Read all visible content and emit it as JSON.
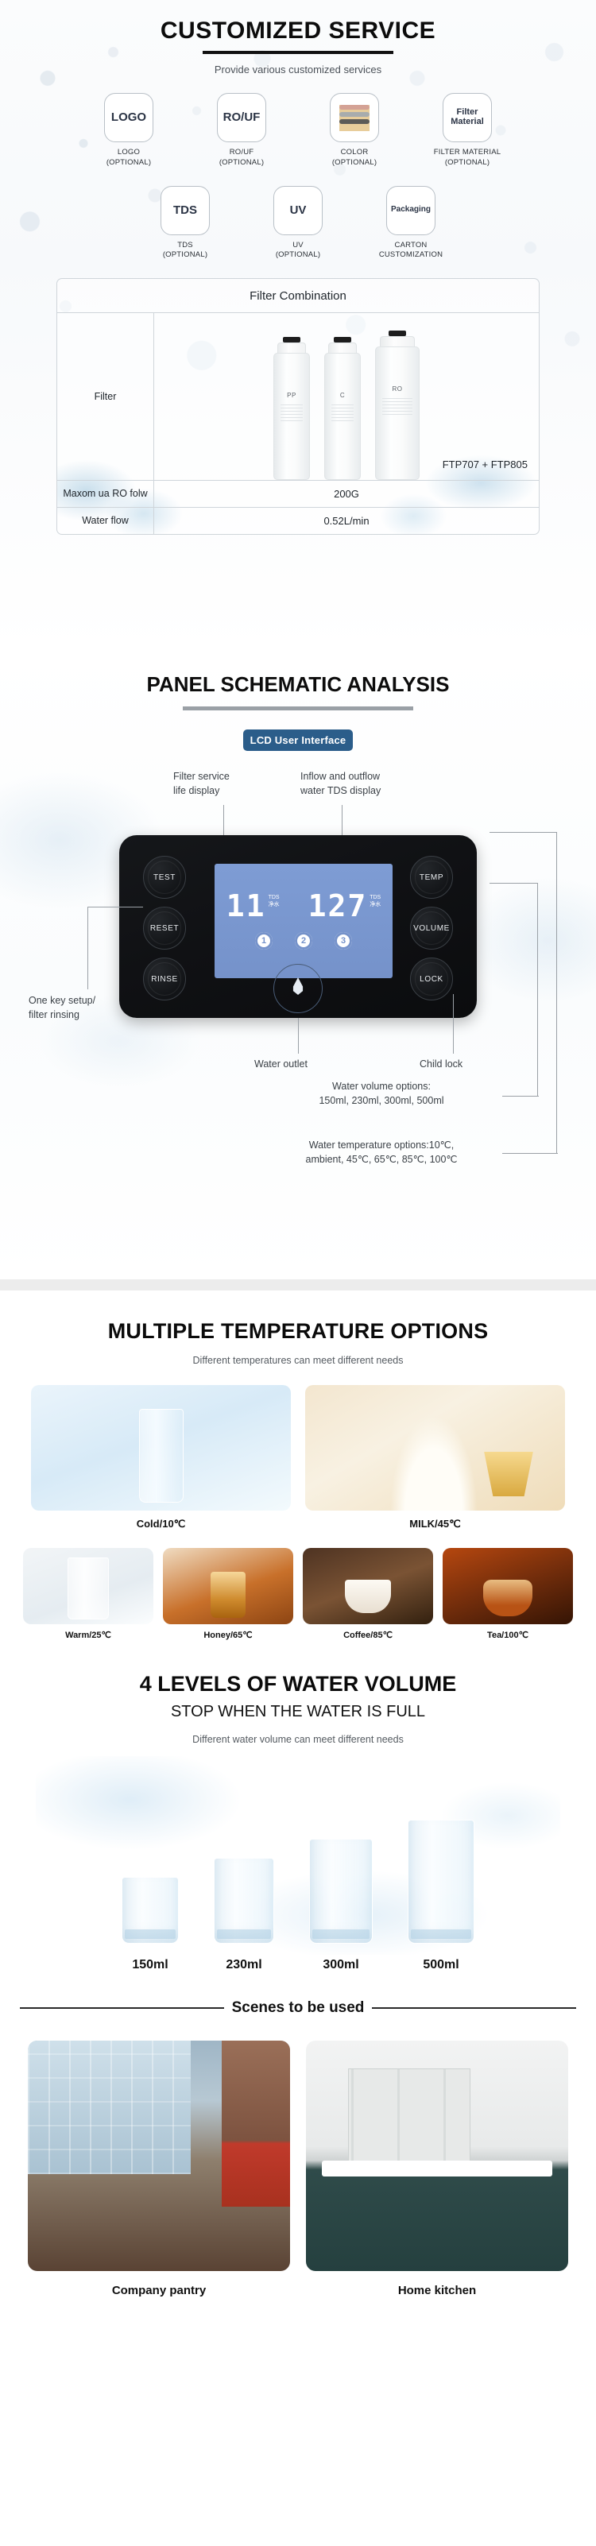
{
  "customized": {
    "title": "CUSTOMIZED SERVICE",
    "subtitle": "Provide various customized services",
    "options_row1": [
      {
        "box": "LOGO",
        "caption_1": "LOGO",
        "caption_2": "(OPTIONAL)"
      },
      {
        "box": "RO/UF",
        "caption_1": "RO/UF",
        "caption_2": "(OPTIONAL)"
      },
      {
        "box": "",
        "caption_1": "COLOR",
        "caption_2": "(OPTIONAL)"
      },
      {
        "box": "Filter Material",
        "caption_1": "FILTER MATERIAL",
        "caption_2": "(OPTIONAL)"
      }
    ],
    "options_row2": [
      {
        "box": "TDS",
        "caption_1": "TDS",
        "caption_2": "(OPTIONAL)"
      },
      {
        "box": "UV",
        "caption_1": "UV",
        "caption_2": "(OPTIONAL)"
      },
      {
        "box": "Packaging",
        "caption_1": "CARTON",
        "caption_2": "CUSTOMIZATION"
      }
    ],
    "color_swatches": [
      "#e8cd9b",
      "#d4a295",
      "#a8acad",
      "#5c5b58"
    ],
    "filter_table": {
      "header": "Filter Combination",
      "rows": [
        {
          "label": "Filter",
          "value": "FTP707 + FTP805"
        },
        {
          "label": "Maxom ua RO folw",
          "value": "200G"
        },
        {
          "label": "Water flow",
          "value": "0.52L/min"
        }
      ],
      "cartridges": [
        "PP",
        "C",
        "RO"
      ]
    }
  },
  "panel": {
    "title": "PANEL SCHEMATIC ANALYSIS",
    "badge": "LCD User Interface",
    "badge_color": "#2b5d8a",
    "annotations": {
      "filter_life": "Filter service\nlife display",
      "tds_display": "Inflow and outflow\nwater TDS display",
      "one_key": "One key setup/\nfilter rinsing",
      "water_outlet": "Water outlet",
      "child_lock": "Child lock",
      "volume_options": "Water volume options:\n150ml, 230ml, 300ml, 500ml",
      "temperature_options": "Water temperature options:10℃,\nambient, 45℃, 65℃, 85℃, 100℃"
    },
    "buttons_left": [
      "TEST",
      "RESET",
      "RINSE"
    ],
    "buttons_right": [
      "TEMP",
      "VOLUME",
      "LOCK"
    ],
    "lcd": {
      "value_left": "11",
      "value_right": "127",
      "unit_top": "TDS",
      "unit_bottom": "净水",
      "indicators": [
        "1",
        "2",
        "3"
      ]
    }
  },
  "temperature": {
    "title": "MULTIPLE TEMPERATURE OPTIONS",
    "subtitle": "Different temperatures can meet different needs",
    "big_items": [
      {
        "caption": "Cold/10℃"
      },
      {
        "caption": "MILK/45℃"
      }
    ],
    "small_items": [
      {
        "caption": "Warm/25℃"
      },
      {
        "caption": "Honey/65℃"
      },
      {
        "caption": "Coffee/85℃"
      },
      {
        "caption": "Tea/100℃"
      }
    ]
  },
  "volume": {
    "title": "4 LEVELS OF WATER VOLUME",
    "title2": "STOP WHEN THE WATER IS FULL",
    "subtitle": "Different water volume can meet different needs",
    "levels": [
      "150ml",
      "230ml",
      "300ml",
      "500ml"
    ]
  },
  "scenes": {
    "title": "Scenes to be used",
    "items": [
      {
        "caption": "Company pantry"
      },
      {
        "caption": "Home kitchen"
      }
    ]
  }
}
